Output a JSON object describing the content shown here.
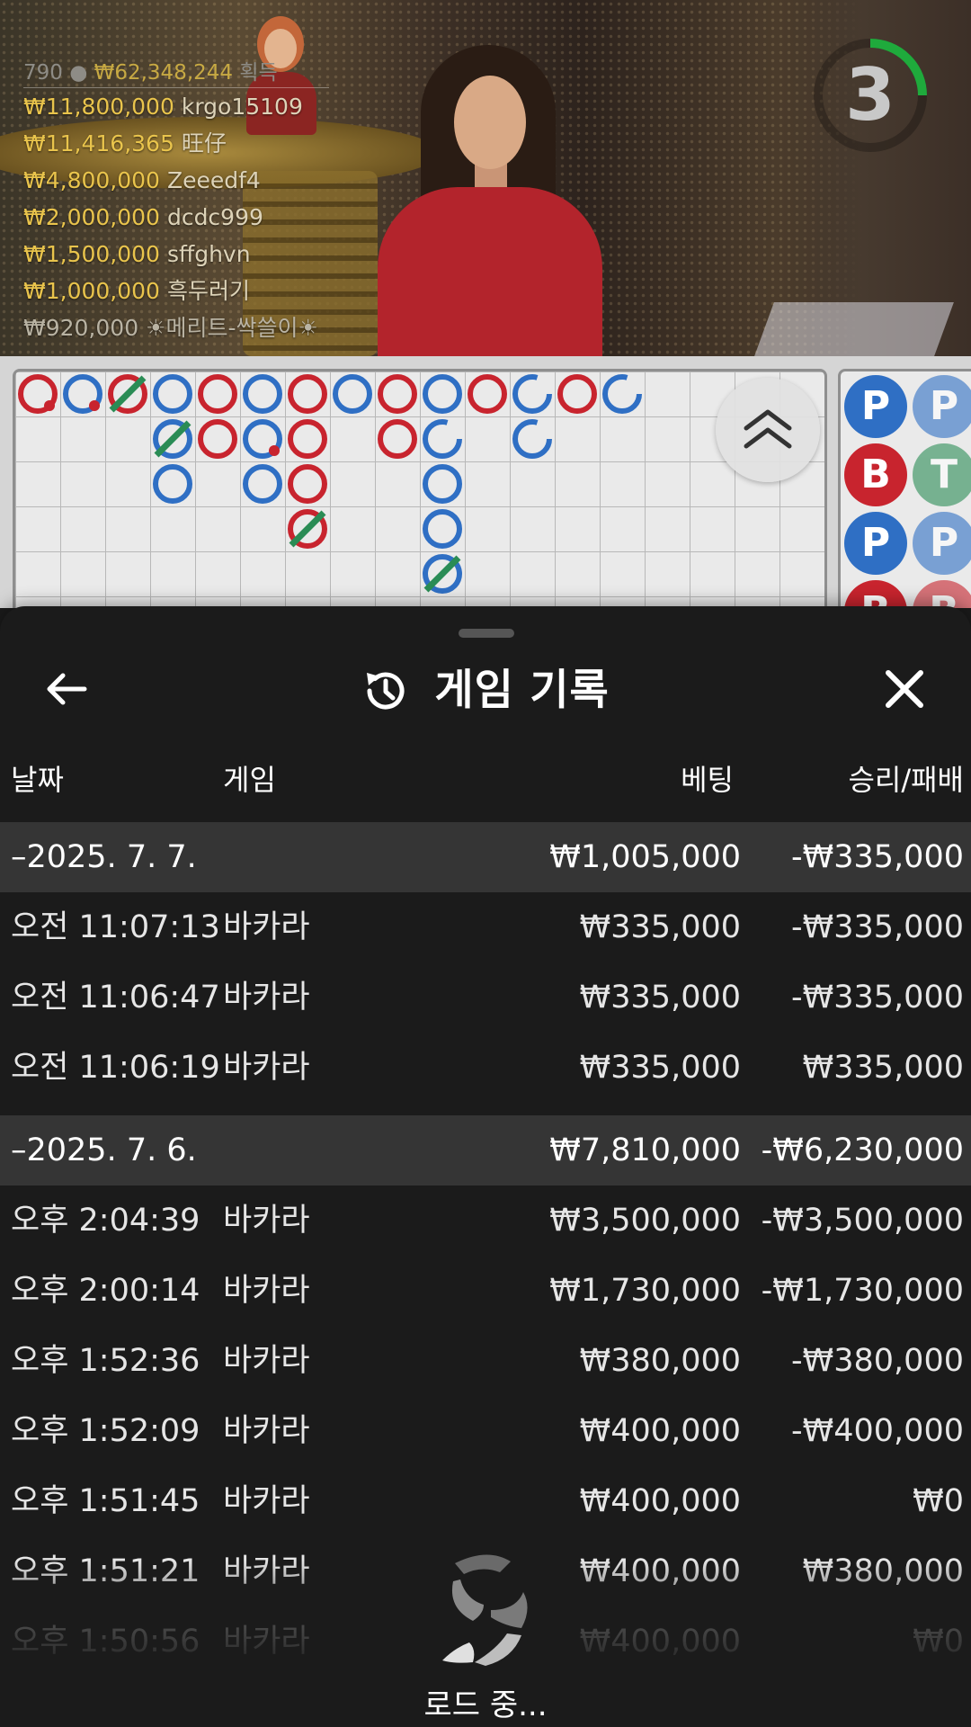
{
  "stream": {
    "leaderboard": {
      "summary_count": "790",
      "summary_amount": "₩62,348,244",
      "summary_suffix": "획득",
      "winners": [
        {
          "amount": "₩11,800,000",
          "name": "krgo15109"
        },
        {
          "amount": "₩11,416,365",
          "name": "旺仔"
        },
        {
          "amount": "₩4,800,000",
          "name": "Zeeedf4"
        },
        {
          "amount": "₩2,000,000",
          "name": "dcdc999"
        },
        {
          "amount": "₩1,500,000",
          "name": "sffghvn"
        },
        {
          "amount": "₩1,000,000",
          "name": "흑두러기"
        },
        {
          "amount": "₩920,000",
          "name": "☀메리트-싹쓸이☀"
        }
      ]
    },
    "countdown": "3",
    "colors": {
      "timer_arc": "#1faa3c",
      "winner_amount": "#e9c44c"
    }
  },
  "roadmap": {
    "bead_road": [
      [
        "P",
        "P"
      ],
      [
        "B",
        "T"
      ],
      [
        "P",
        "P"
      ],
      [
        "B",
        "B"
      ]
    ],
    "colors": {
      "player": "#2f6fc4",
      "banker": "#c8242e",
      "tie": "#2a8c55"
    },
    "collapse_icon": "chevron-double-up-icon"
  },
  "sheet": {
    "title": "게임 기록",
    "title_icon": "history-icon",
    "back_icon": "arrow-left-icon",
    "close_icon": "close-icon",
    "columns": {
      "date": "날짜",
      "game": "게임",
      "bet": "베팅",
      "result": "승리/패배"
    },
    "days": [
      {
        "date": "–2025. 7. 7.",
        "bet_total": "₩1,005,000",
        "result_total": "-₩335,000",
        "records": [
          {
            "time": "오전 11:07:13",
            "game": "바카라",
            "bet": "₩335,000",
            "result": "-₩335,000"
          },
          {
            "time": "오전 11:06:47",
            "game": "바카라",
            "bet": "₩335,000",
            "result": "-₩335,000"
          },
          {
            "time": "오전 11:06:19",
            "game": "바카라",
            "bet": "₩335,000",
            "result": "₩335,000"
          }
        ]
      },
      {
        "date": "–2025. 7. 6.",
        "bet_total": "₩7,810,000",
        "result_total": "-₩6,230,000",
        "records": [
          {
            "time": "오후 2:04:39",
            "game": "바카라",
            "bet": "₩3,500,000",
            "result": "-₩3,500,000"
          },
          {
            "time": "오후 2:00:14",
            "game": "바카라",
            "bet": "₩1,730,000",
            "result": "-₩1,730,000"
          },
          {
            "time": "오후 1:52:36",
            "game": "바카라",
            "bet": "₩380,000",
            "result": "-₩380,000"
          },
          {
            "time": "오후 1:52:09",
            "game": "바카라",
            "bet": "₩400,000",
            "result": "-₩400,000"
          },
          {
            "time": "오후 1:51:45",
            "game": "바카라",
            "bet": "₩400,000",
            "result": "₩0"
          },
          {
            "time": "오후 1:51:21",
            "game": "바카라",
            "bet": "₩400,000",
            "result": "₩380,000"
          },
          {
            "time": "오후 1:50:56",
            "game": "바카라",
            "bet": "₩400,000",
            "result": "₩0"
          }
        ]
      }
    ],
    "loading_text": "로드 중..."
  }
}
